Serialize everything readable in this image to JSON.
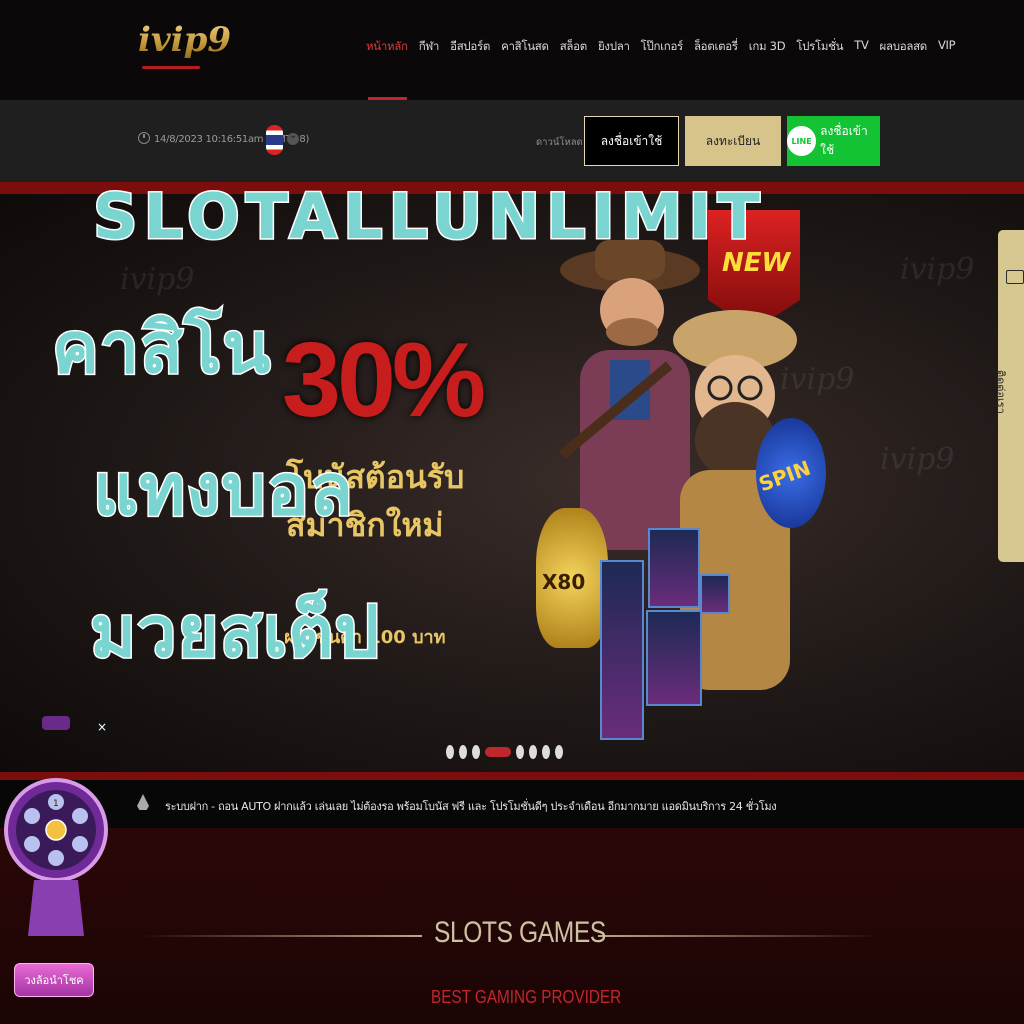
{
  "header": {
    "logo_text": "ivip9",
    "menu": [
      "หน้าหลัก",
      "กีฬา",
      "อีสปอร์ต",
      "คาสิโนสด",
      "สล็อต",
      "ยิงปลา",
      "โป๊กเกอร์",
      "ล็อตเตอรี่",
      "เกม 3D",
      "โปรโมชั่น",
      "TV",
      "ผลบอลสด",
      "VIP"
    ],
    "active_menu": "หน้าหลัก"
  },
  "subbar": {
    "datetime": "14/8/2023 10:16:51am (GMT+8)",
    "download_label": "ดาวน์โหลด",
    "login_label": "ลงชื่อเข้าใช้",
    "register_label": "ลงทะเบียน",
    "line_badge": "LINE",
    "line_login_label": "ลงชื่อเข้าใช้"
  },
  "banner": {
    "badge_new": "NEW",
    "promo_percent": "30%",
    "promo_line1": "โบนัสต้อนรับ",
    "promo_line2": "สมาชิกใหม่",
    "promo_line3": "ฝากขั้นต่ำ 100 บาท",
    "coin_bag": "X80",
    "spin_badge": "SPIN",
    "watermark": "ivip9",
    "slide_count": 8,
    "active_slide": 3
  },
  "overlay": {
    "line1": "SLOTALLUNLIMIT",
    "line2": "คาสิโน",
    "line3": "แทงบอล",
    "line4": "มวยสเต็ป"
  },
  "sidetab": {
    "label": "ติดต่อเรา"
  },
  "ticker": {
    "text": "ระบบฝาก - ถอน AUTO ฝากแล้ว เล่นเลย ไม่ต้องรอ พร้อมโบนัส ฟรี และ โปรโมชั่นดีๆ ประจำเดือน อีกมากมาย แอดมินบริการ 24 ชั่วโมง"
  },
  "slots": {
    "title": "SLOTS GAMES",
    "subtitle": "BEST GAMING PROVIDER"
  },
  "wheel": {
    "close": "×",
    "label": "วงล้อนำโชค",
    "center_numbers": [
      "1"
    ]
  },
  "colors": {
    "accent_red": "#c0272d",
    "gold": "#d6c48b",
    "line_green": "#14c334",
    "overlay_teal": "#7ad4d0"
  }
}
